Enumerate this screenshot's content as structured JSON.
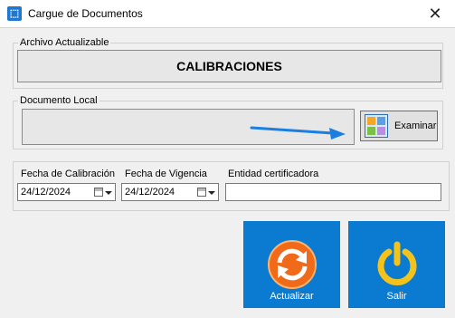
{
  "window": {
    "title": "Cargue de Documentos",
    "close_glyph": "✕",
    "app_glyph": "⬚"
  },
  "archivo": {
    "label": "Archivo Actualizable",
    "value": "CALIBRACIONES"
  },
  "documento": {
    "label": "Documento Local",
    "value": "",
    "button_label": "Examinar"
  },
  "fechas": {
    "calibracion_label": "Fecha de Calibración",
    "calibracion_value": "24/12/2024",
    "vigencia_label": "Fecha de Vigencia",
    "vigencia_value": "24/12/2024",
    "entidad_label": "Entidad certificadora",
    "entidad_value": ""
  },
  "actions": {
    "actualizar_label": "Actualizar",
    "salir_label": "Salir"
  },
  "colors": {
    "tile_blue": "#0a7bd1",
    "arrow_blue": "#1a7fe0",
    "refresh_orange": "#f06a1a",
    "power_yellow": "#f3c21b"
  }
}
